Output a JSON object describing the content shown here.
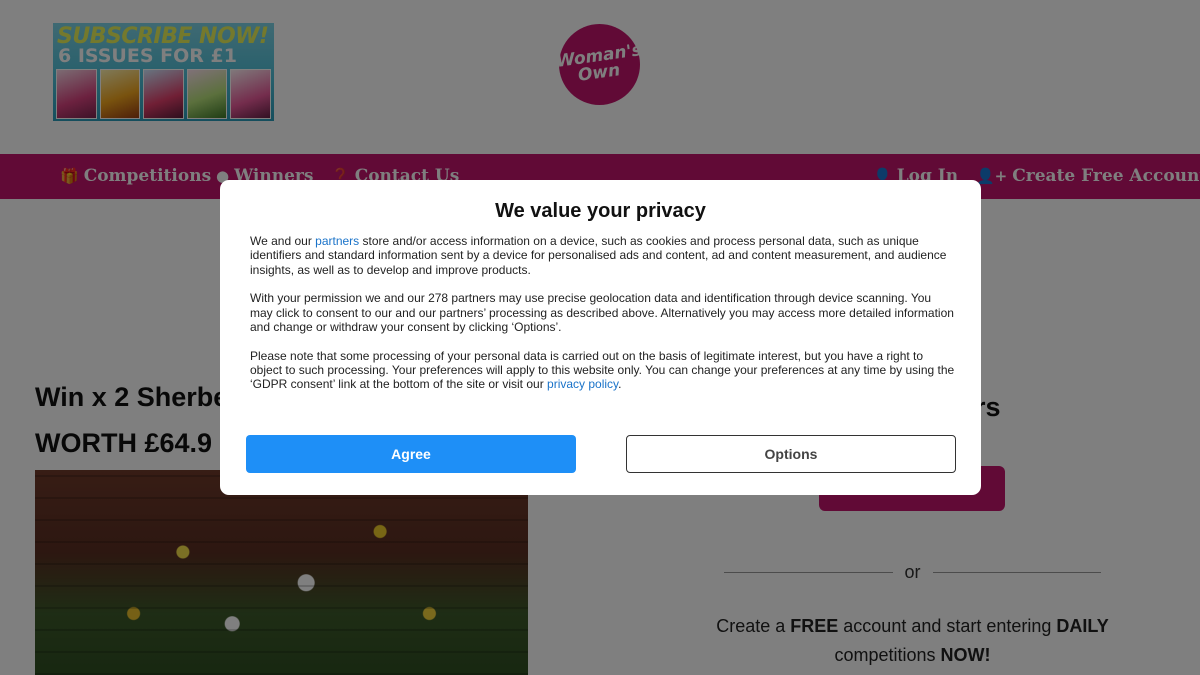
{
  "header": {
    "promo": {
      "line1": "SUBSCRIBE NOW!",
      "line2": "6 ISSUES FOR £1"
    },
    "logo": {
      "line1": "Woman's",
      "line2": "Own"
    }
  },
  "nav": {
    "items": [
      {
        "label": "Competitions",
        "icon": "gift-icon"
      },
      {
        "label": "Winners",
        "icon": "map-pin-icon"
      },
      {
        "label": "Contact Us",
        "icon": "question-icon"
      }
    ],
    "right_items": [
      {
        "label": "Log In",
        "icon": "user-icon"
      },
      {
        "label": "Create Free Account",
        "icon": "user-plus-icon"
      }
    ]
  },
  "article": {
    "title_line1": "Win x 2 Sherbe",
    "title_line2": "WORTH £64.9"
  },
  "sidebar": {
    "heading": "ers",
    "or": "or",
    "create_prefix": "Create a ",
    "create_free": "FREE",
    "create_mid": " account and start entering ",
    "create_daily": "DAILY",
    "create_comp": " competitions ",
    "create_now": "NOW!"
  },
  "consent": {
    "title": "We value your privacy",
    "p1_pre": "We and our ",
    "p1_link": "partners",
    "p1_post": " store and/or access information on a device, such as cookies and process personal data, such as unique identifiers and standard information sent by a device for personalised ads and content, ad and content measurement, and audience insights, as well as to develop and improve products.",
    "p2": "With your permission we and our 278 partners may use precise geolocation data and identification through device scanning. You may click to consent to our and our partners’ processing as described above. Alternatively you may access more detailed information and change or withdraw your consent by clicking ‘Options’.",
    "p3_pre": "Please note that some processing of your personal data is carried out on the basis of legitimate interest, but you have a right to object to such processing. Your preferences will apply to this website only. You can change your preferences at any time by using the ‘GDPR consent’ link at the bottom of the site or visit our ",
    "p3_link": "privacy policy",
    "p3_post": ".",
    "agree_label": "Agree",
    "options_label": "Options"
  },
  "colors": {
    "brand": "#c3146c",
    "agree": "#1e8ff7",
    "link": "#1a73c9"
  }
}
